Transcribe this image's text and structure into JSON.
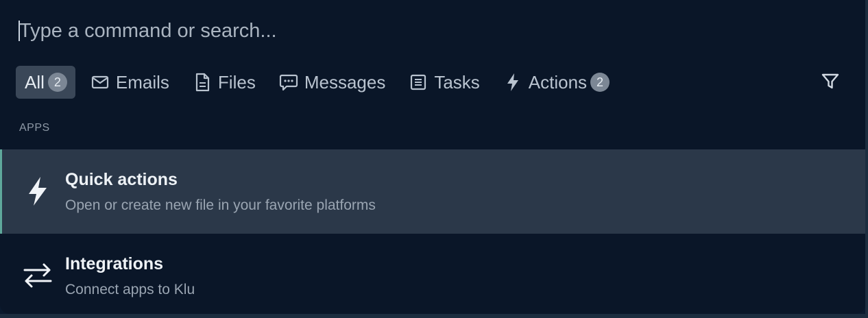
{
  "search": {
    "placeholder": "Type a command or search..."
  },
  "filters": [
    {
      "label": "All",
      "badge": "2",
      "icon": "none",
      "active": true
    },
    {
      "label": "Emails",
      "icon": "mail-icon"
    },
    {
      "label": "Files",
      "icon": "file-icon"
    },
    {
      "label": "Messages",
      "icon": "message-icon"
    },
    {
      "label": "Tasks",
      "icon": "list-icon"
    },
    {
      "label": "Actions",
      "badge": "2",
      "icon": "lightning-icon"
    }
  ],
  "filter_button_icon": "funnel-icon",
  "section": {
    "label": "APPS"
  },
  "results": [
    {
      "title": "Quick actions",
      "subtitle": "Open or create new file in your favorite platforms",
      "icon": "lightning-icon",
      "selected": true
    },
    {
      "title": "Integrations",
      "subtitle": "Connect apps to Klu",
      "icon": "swap-arrows-icon",
      "selected": false
    }
  ],
  "colors": {
    "background": "#0a1628",
    "selected_row": "#2b3849",
    "active_chip": "#3a4758",
    "accent_bar": "#5fa89b",
    "badge": "#7c8795"
  }
}
